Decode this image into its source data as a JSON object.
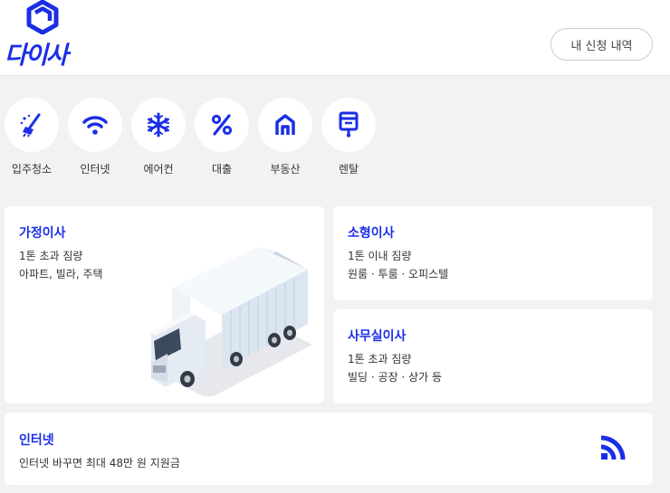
{
  "header": {
    "logo_text": "다이사",
    "history_button": "내 신청 내역"
  },
  "categories": [
    {
      "label": "입주청소",
      "icon": "cleaning-icon"
    },
    {
      "label": "인터넷",
      "icon": "wifi-icon"
    },
    {
      "label": "에어컨",
      "icon": "snowflake-icon"
    },
    {
      "label": "대출",
      "icon": "percent-icon"
    },
    {
      "label": "부동산",
      "icon": "house-icon"
    },
    {
      "label": "렌탈",
      "icon": "rental-icon"
    }
  ],
  "cards": {
    "home_move": {
      "title": "가정이사",
      "line1": "1톤 초과 짐량",
      "line2": "아파트, 빌라, 주택"
    },
    "small_move": {
      "title": "소형이사",
      "line1": "1톤 이내 짐량",
      "line2": "원룸 · 투룸 · 오피스텔"
    },
    "office_move": {
      "title": "사무실이사",
      "line1": "1톤 초과 짐량",
      "line2": "빌딩 · 공장 · 상가 등"
    },
    "internet": {
      "title": "인터넷",
      "line1": "인터넷 바꾸면 최대 48만 원 지원금"
    }
  },
  "colors": {
    "accent": "#1b2ee6",
    "background": "#f1f2f4"
  }
}
